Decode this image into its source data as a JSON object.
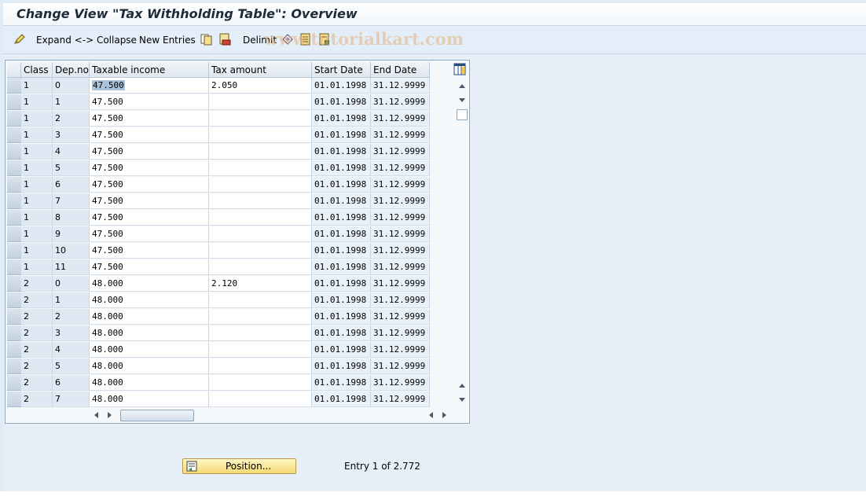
{
  "window": {
    "title": "Change View \"Tax Withholding Table\": Overview"
  },
  "toolbar": {
    "expand_collapse_label": "Expand <-> Collapse",
    "new_entries_label": "New Entries",
    "delimit_label": "Delimit",
    "icons": [
      "edit-toggle-icon",
      "copy-icon",
      "delete-icon",
      "delimit-icon",
      "select-all-icon",
      "deselect-icon"
    ]
  },
  "watermark": {
    "text": "www.tutorialkart.com"
  },
  "table": {
    "columns": [
      "Class",
      "Dep.no",
      "Taxable income",
      "Tax amount",
      "Start Date",
      "End Date"
    ],
    "rows": [
      [
        "1",
        "0",
        "47.500",
        "2.050",
        "01.01.1998",
        "31.12.9999"
      ],
      [
        "1",
        "1",
        "47.500",
        "",
        "01.01.1998",
        "31.12.9999"
      ],
      [
        "1",
        "2",
        "47.500",
        "",
        "01.01.1998",
        "31.12.9999"
      ],
      [
        "1",
        "3",
        "47.500",
        "",
        "01.01.1998",
        "31.12.9999"
      ],
      [
        "1",
        "4",
        "47.500",
        "",
        "01.01.1998",
        "31.12.9999"
      ],
      [
        "1",
        "5",
        "47.500",
        "",
        "01.01.1998",
        "31.12.9999"
      ],
      [
        "1",
        "6",
        "47.500",
        "",
        "01.01.1998",
        "31.12.9999"
      ],
      [
        "1",
        "7",
        "47.500",
        "",
        "01.01.1998",
        "31.12.9999"
      ],
      [
        "1",
        "8",
        "47.500",
        "",
        "01.01.1998",
        "31.12.9999"
      ],
      [
        "1",
        "9",
        "47.500",
        "",
        "01.01.1998",
        "31.12.9999"
      ],
      [
        "1",
        "10",
        "47.500",
        "",
        "01.01.1998",
        "31.12.9999"
      ],
      [
        "1",
        "11",
        "47.500",
        "",
        "01.01.1998",
        "31.12.9999"
      ],
      [
        "2",
        "0",
        "48.000",
        "2.120",
        "01.01.1998",
        "31.12.9999"
      ],
      [
        "2",
        "1",
        "48.000",
        "",
        "01.01.1998",
        "31.12.9999"
      ],
      [
        "2",
        "2",
        "48.000",
        "",
        "01.01.1998",
        "31.12.9999"
      ],
      [
        "2",
        "3",
        "48.000",
        "",
        "01.01.1998",
        "31.12.9999"
      ],
      [
        "2",
        "4",
        "48.000",
        "",
        "01.01.1998",
        "31.12.9999"
      ],
      [
        "2",
        "5",
        "48.000",
        "",
        "01.01.1998",
        "31.12.9999"
      ],
      [
        "2",
        "6",
        "48.000",
        "",
        "01.01.1998",
        "31.12.9999"
      ],
      [
        "2",
        "7",
        "48.000",
        "",
        "01.01.1998",
        "31.12.9999"
      ]
    ]
  },
  "footer": {
    "position_button_label": "Position...",
    "entry_text": "Entry 1 of 2.772"
  },
  "colors": {
    "title": "#1d2a3a",
    "button_fill": "#f4d978",
    "background": "#dfebf5"
  }
}
